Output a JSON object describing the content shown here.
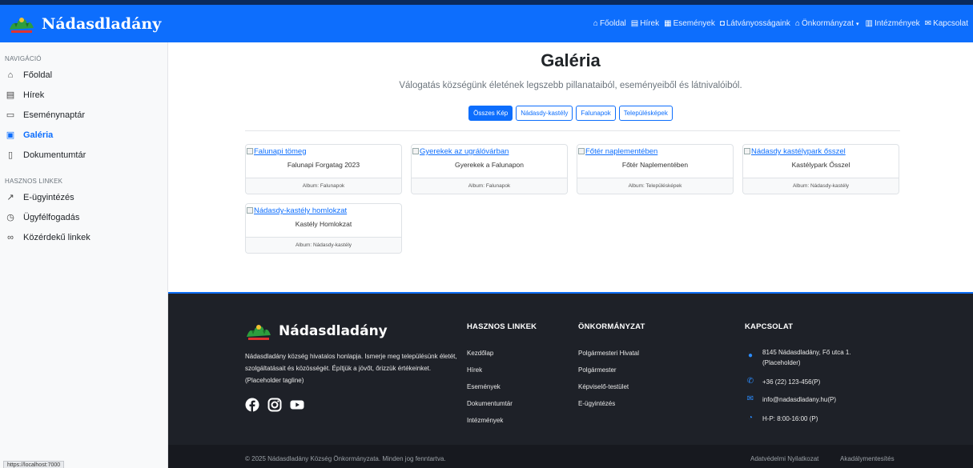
{
  "header": {
    "brand": "Nádasdladány",
    "nav": [
      {
        "label": "Főoldal",
        "icon": "home-icon"
      },
      {
        "label": "Hírek",
        "icon": "newspaper-icon"
      },
      {
        "label": "Események",
        "icon": "calendar-icon"
      },
      {
        "label": "Látványosságaink",
        "icon": "camera-icon"
      },
      {
        "label": "Önkormányzat",
        "icon": "bank-icon",
        "dropdown": true
      },
      {
        "label": "Intézmények",
        "icon": "building-icon"
      },
      {
        "label": "Kapcsolat",
        "icon": "envelope-icon"
      }
    ]
  },
  "sidebar": {
    "nav_heading": "NAVIGÁCIÓ",
    "nav_items": [
      {
        "label": "Főoldal",
        "icon": "home-icon"
      },
      {
        "label": "Hírek",
        "icon": "newspaper-icon"
      },
      {
        "label": "Eseménynaptár",
        "icon": "calendar-icon"
      },
      {
        "label": "Galéria",
        "icon": "image-icon",
        "active": true
      },
      {
        "label": "Dokumentumtár",
        "icon": "document-icon"
      }
    ],
    "links_heading": "HASZNOS LINKEK",
    "link_items": [
      {
        "label": "E-ügyintézés",
        "icon": "external-link-icon"
      },
      {
        "label": "Ügyfélfogadás",
        "icon": "clock-icon"
      },
      {
        "label": "Közérdekű linkek",
        "icon": "link-icon"
      }
    ]
  },
  "main": {
    "title": "Galéria",
    "subtitle": "Válogatás községünk életének legszebb pillanataiból, eseményeiből és látnivalóiból.",
    "filters": [
      {
        "label": "Összes Kép",
        "active": true
      },
      {
        "label": "Nádasdy-kastély",
        "active": false
      },
      {
        "label": "Falunapok",
        "active": false
      },
      {
        "label": "Településképek",
        "active": false
      }
    ],
    "cards": [
      {
        "alt": "Falunapi tömeg",
        "title": "Falunapi Forgatag 2023",
        "album": "Album: Falunapok"
      },
      {
        "alt": "Gyerekek az ugrálóvárban",
        "title": "Gyerekek a Falunapon",
        "album": "Album: Falunapok"
      },
      {
        "alt": "Főtér naplementében",
        "title": "Főtér Naplementében",
        "album": "Album: Településképek"
      },
      {
        "alt": "Nádasdy kastélypark ősszel",
        "title": "Kastélypark Ősszel",
        "album": "Album: Nádasdy-kastély"
      },
      {
        "alt": "Nádasdy-kastély homlokzat",
        "title": "Kastély Homlokzat",
        "album": "Album: Nádasdy-kastély"
      }
    ]
  },
  "footer": {
    "brand": "Nádasdladány",
    "tagline": "Nádasdladány község hivatalos honlapja. Ismerje meg településünk életét, szolgáltatásait és közösségét. Építjük a jövőt, őrizzük értékeinket. (Placeholder tagline)",
    "social": [
      "facebook-icon",
      "instagram-icon",
      "youtube-icon"
    ],
    "col1_title": "HASZNOS LINKEK",
    "col1_links": [
      "Kezdőlap",
      "Hírek",
      "Események",
      "Dokumentumtár",
      "Intézmények"
    ],
    "col2_title": "ÖNKORMÁNYZAT",
    "col2_links": [
      "Polgármesteri Hivatal",
      "Polgármester",
      "Képviselő-testület",
      "E-ügyintézés"
    ],
    "col3_title": "KAPCSOLAT",
    "contacts": [
      {
        "icon": "map-pin-icon",
        "line1": "8145 Nádasdladány, Fő utca 1.",
        "line2": "(Placeholder)"
      },
      {
        "icon": "phone-icon",
        "line1": "+36 (22) 123-456(P)",
        "line2": ""
      },
      {
        "icon": "envelope-icon",
        "line1": "info@nadasdladany.hu(P)",
        "line2": ""
      },
      {
        "icon": "clock-icon",
        "line1": "H-P: 8:00-16:00 (P)",
        "line2": ""
      }
    ],
    "copyright": "© 2025 Nádasdladány Község Önkormányzata. Minden jog fenntartva.",
    "privacy": "Adatvédelmi Nyilatkozat",
    "accessibility": "Akadálymentesítés"
  },
  "statusbar": {
    "url": "https://localhost:7000"
  },
  "colors": {
    "primary": "#0d6efd",
    "footer_bg": "#1e2128"
  }
}
